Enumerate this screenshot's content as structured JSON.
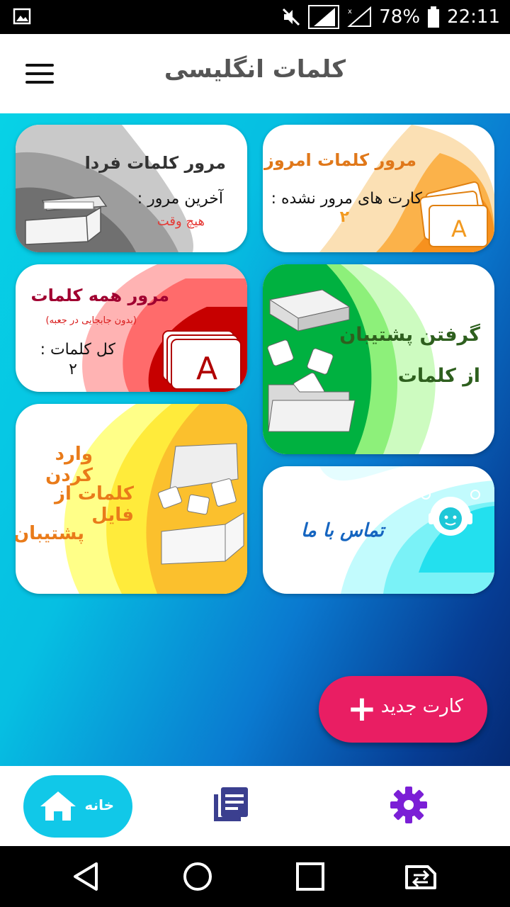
{
  "status_bar": {
    "battery": "78%",
    "time": "22:11"
  },
  "app_bar": {
    "title": "کلمات انگلیسی"
  },
  "cards": {
    "review_today": {
      "title": "مرور کلمات امروز",
      "label": "کارت های مرور نشده :",
      "value": "۲"
    },
    "review_tomorrow": {
      "title": "مرور کلمات فردا",
      "label": "آخرین مرور :",
      "value": "هیچ وقت"
    },
    "review_all": {
      "title": "مرور همه کلمات",
      "subtitle": "(بدون جابجایی در جعبه)",
      "label": "کل کلمات :",
      "value": "۲"
    },
    "backup": {
      "line1": "گرفتن پشتیبان",
      "line2": "از کلمات"
    },
    "import": {
      "line1": "وارد کردن",
      "line2": "کلمات از فایل",
      "line3": "پشتیبان"
    },
    "contact": {
      "title": "تماس با ما"
    }
  },
  "fab": {
    "label": "کارت جدید"
  },
  "bottom_nav": {
    "home_label": "خانه"
  },
  "colors": {
    "accent": "#e91e63",
    "nav_active": "#11c8e8",
    "settings": "#7b1fd6",
    "book": "#3b3f8f"
  }
}
